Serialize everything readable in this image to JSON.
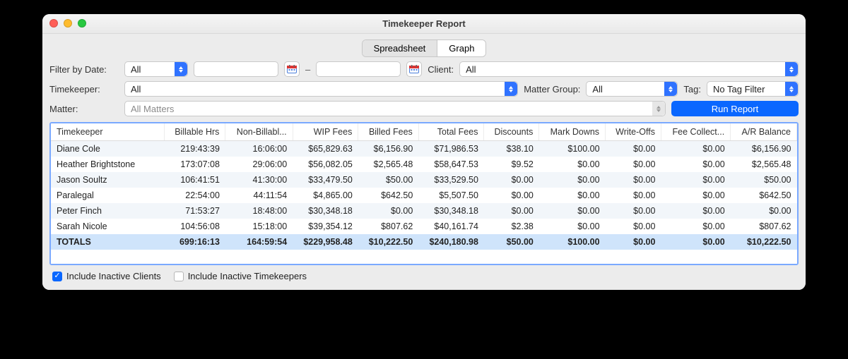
{
  "window": {
    "title": "Timekeeper Report"
  },
  "tabs": {
    "spreadsheet": "Spreadsheet",
    "graph": "Graph",
    "active": "spreadsheet"
  },
  "filters": {
    "filter_by_date_label": "Filter by Date:",
    "filter_by_date_value": "All",
    "date_from": "",
    "date_to": "",
    "client_label": "Client:",
    "client_value": "All",
    "timekeeper_label": "Timekeeper:",
    "timekeeper_value": "All",
    "matter_group_label": "Matter Group:",
    "matter_group_value": "All",
    "tag_label": "Tag:",
    "tag_value": "No Tag Filter",
    "matter_label": "Matter:",
    "matter_placeholder": "All Matters",
    "run_report_label": "Run Report"
  },
  "table": {
    "headers": [
      "Timekeeper",
      "Billable Hrs",
      "Non-Billabl...",
      "WIP Fees",
      "Billed Fees",
      "Total Fees",
      "Discounts",
      "Mark Downs",
      "Write-Offs",
      "Fee Collect...",
      "A/R Balance"
    ],
    "rows": [
      [
        "Diane Cole",
        "219:43:39",
        "16:06:00",
        "$65,829.63",
        "$6,156.90",
        "$71,986.53",
        "$38.10",
        "$100.00",
        "$0.00",
        "$0.00",
        "$6,156.90"
      ],
      [
        "Heather Brightstone",
        "173:07:08",
        "29:06:00",
        "$56,082.05",
        "$2,565.48",
        "$58,647.53",
        "$9.52",
        "$0.00",
        "$0.00",
        "$0.00",
        "$2,565.48"
      ],
      [
        "Jason Soultz",
        "106:41:51",
        "41:30:00",
        "$33,479.50",
        "$50.00",
        "$33,529.50",
        "$0.00",
        "$0.00",
        "$0.00",
        "$0.00",
        "$50.00"
      ],
      [
        "Paralegal",
        "22:54:00",
        "44:11:54",
        "$4,865.00",
        "$642.50",
        "$5,507.50",
        "$0.00",
        "$0.00",
        "$0.00",
        "$0.00",
        "$642.50"
      ],
      [
        "Peter Finch",
        "71:53:27",
        "18:48:00",
        "$30,348.18",
        "$0.00",
        "$30,348.18",
        "$0.00",
        "$0.00",
        "$0.00",
        "$0.00",
        "$0.00"
      ],
      [
        "Sarah Nicole",
        "104:56:08",
        "15:18:00",
        "$39,354.12",
        "$807.62",
        "$40,161.74",
        "$2.38",
        "$0.00",
        "$0.00",
        "$0.00",
        "$807.62"
      ]
    ],
    "totals": [
      "TOTALS",
      "699:16:13",
      "164:59:54",
      "$229,958.48",
      "$10,222.50",
      "$240,180.98",
      "$50.00",
      "$100.00",
      "$0.00",
      "$0.00",
      "$10,222.50"
    ]
  },
  "footer": {
    "include_inactive_clients_label": "Include Inactive Clients",
    "include_inactive_clients_checked": true,
    "include_inactive_timekeepers_label": "Include Inactive Timekeepers",
    "include_inactive_timekeepers_checked": false
  }
}
